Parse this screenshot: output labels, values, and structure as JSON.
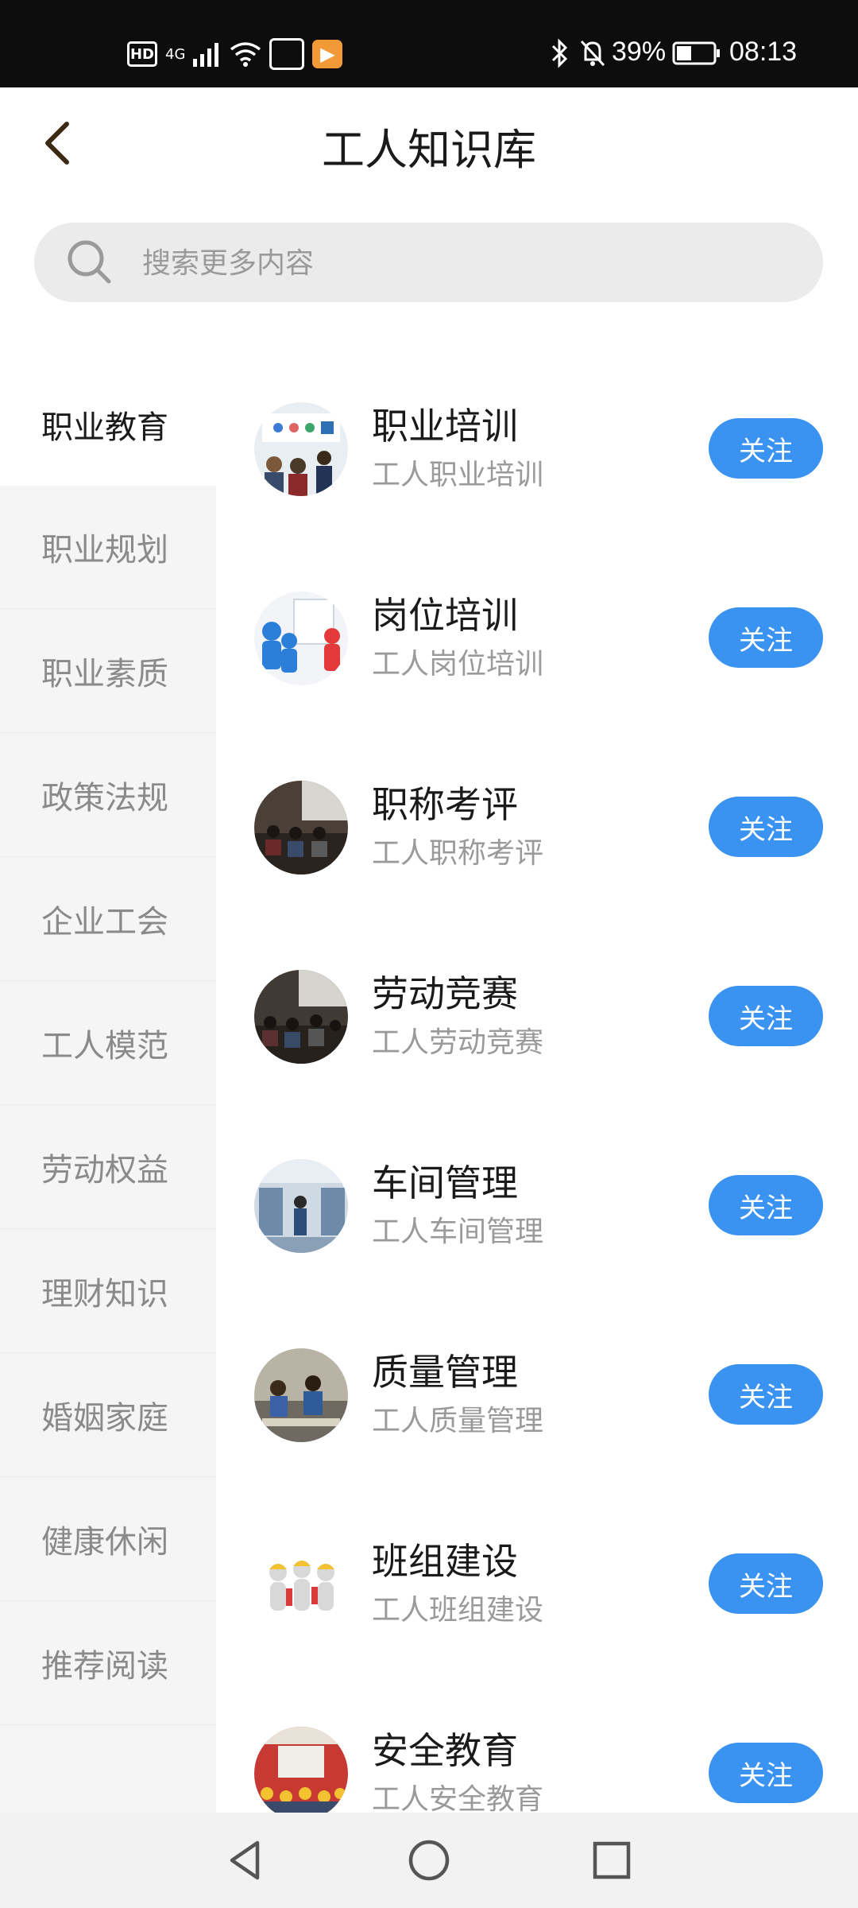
{
  "status_bar": {
    "hd": "HD",
    "network": "4G",
    "battery": "39%",
    "time": "08:13"
  },
  "header": {
    "title": "工人知识库",
    "back_icon": "chevron-left-icon"
  },
  "search": {
    "placeholder": "搜索更多内容",
    "icon": "search-icon"
  },
  "sidebar": {
    "items": [
      {
        "label": "职业教育",
        "active": true
      },
      {
        "label": "职业规划",
        "active": false
      },
      {
        "label": "职业素质",
        "active": false
      },
      {
        "label": "政策法规",
        "active": false
      },
      {
        "label": "企业工会",
        "active": false
      },
      {
        "label": "工人模范",
        "active": false
      },
      {
        "label": "劳动权益",
        "active": false
      },
      {
        "label": "理财知识",
        "active": false
      },
      {
        "label": "婚姻家庭",
        "active": false
      },
      {
        "label": "健康休闲",
        "active": false
      },
      {
        "label": "推荐阅读",
        "active": false
      }
    ]
  },
  "list": {
    "follow_label": "关注",
    "items": [
      {
        "title": "职业培训",
        "subtitle": "工人职业培训"
      },
      {
        "title": "岗位培训",
        "subtitle": "工人岗位培训"
      },
      {
        "title": "职称考评",
        "subtitle": "工人职称考评"
      },
      {
        "title": "劳动竞赛",
        "subtitle": "工人劳动竞赛"
      },
      {
        "title": "车间管理",
        "subtitle": "工人车间管理"
      },
      {
        "title": "质量管理",
        "subtitle": "工人质量管理"
      },
      {
        "title": "班组建设",
        "subtitle": "工人班组建设"
      },
      {
        "title": "安全教育",
        "subtitle": "工人安全教育"
      }
    ]
  },
  "colors": {
    "accent": "#3a93f0",
    "sidebar_bg": "#f5f5f5",
    "search_bg": "#ebebeb"
  },
  "nav": {
    "back": "triangle-back-icon",
    "home": "circle-home-icon",
    "recents": "square-recents-icon"
  }
}
